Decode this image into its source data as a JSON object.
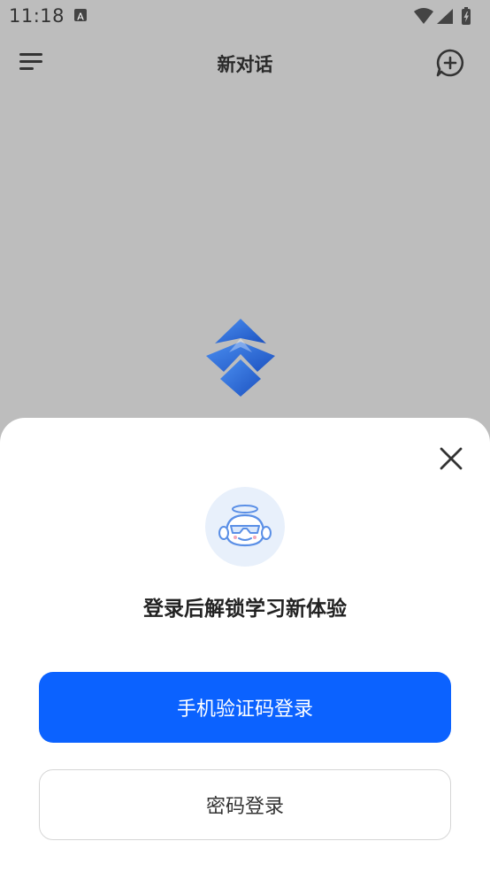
{
  "status_bar": {
    "time": "11:18",
    "icons": [
      "notification-a-icon",
      "wifi-icon",
      "signal-icon",
      "battery-icon"
    ]
  },
  "app_bar": {
    "title": "新对话",
    "left_icon": "menu-icon",
    "right_icon": "new-chat-icon"
  },
  "center": {
    "logo": "app-logo-icon"
  },
  "login_sheet": {
    "close_icon": "close-icon",
    "avatar_icon": "robot-avatar-icon",
    "heading": "登录后解锁学习新体验",
    "primary_button": "手机验证码登录",
    "secondary_button": "密码登录"
  },
  "colors": {
    "overlay_bg": "#bdbdbd",
    "primary": "#0b62ff",
    "sheet_bg": "#ffffff",
    "logo_blue": "#2f6fd8"
  }
}
